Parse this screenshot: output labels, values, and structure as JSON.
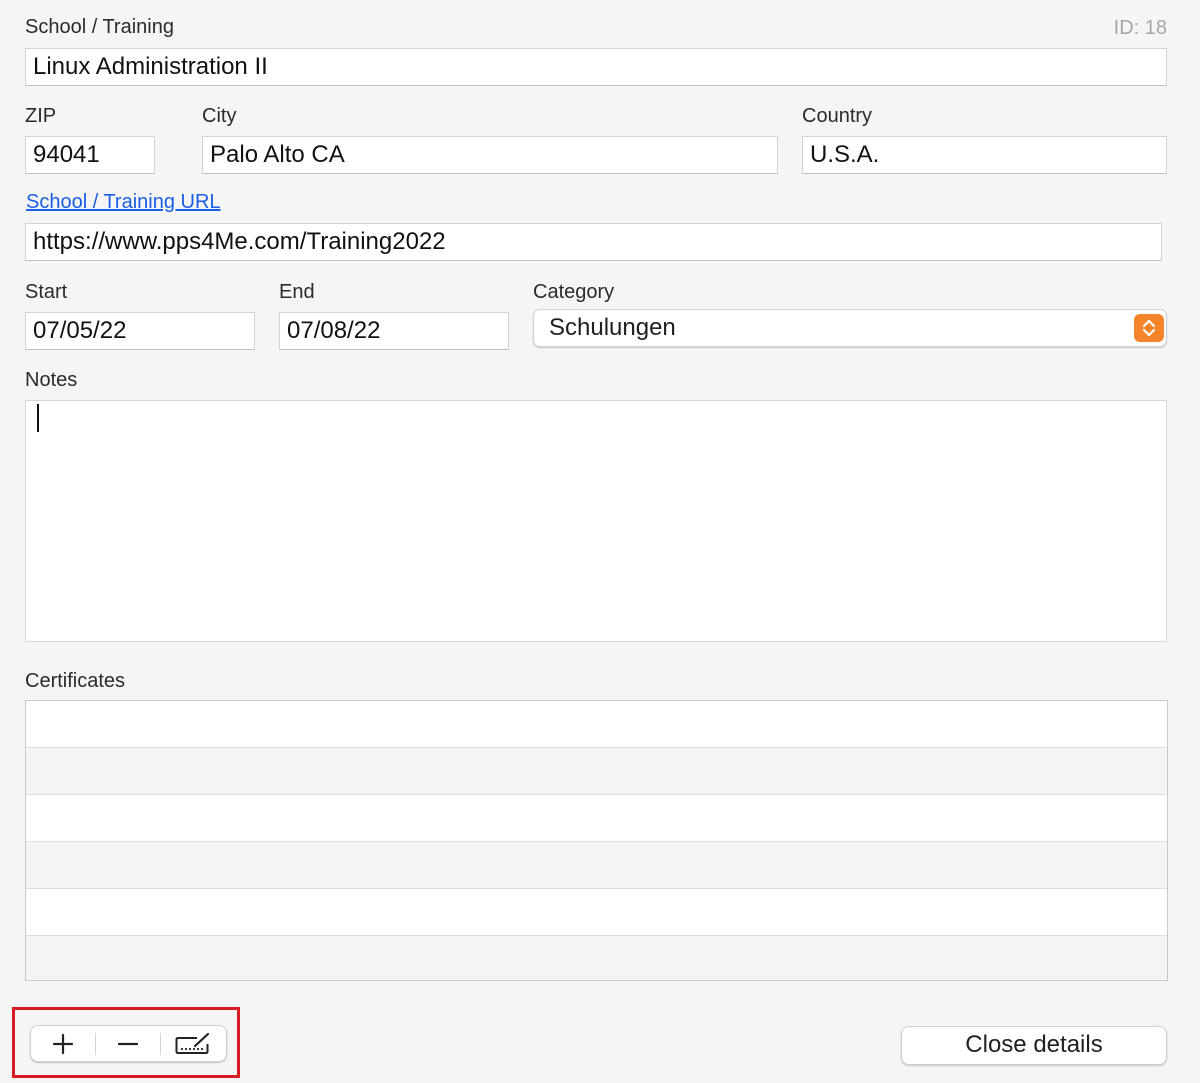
{
  "header": {
    "section_label": "School / Training",
    "id_label": "ID: 18"
  },
  "form": {
    "name_value": "Linux Administration II",
    "zip_label": "ZIP",
    "zip_value": "94041",
    "city_label": "City",
    "city_value": "Palo Alto CA",
    "country_label": "Country",
    "country_value": "U.S.A.",
    "url_link_label": "School / Training URL",
    "url_value": "https://www.pps4Me.com/Training2022",
    "start_label": "Start",
    "start_value": "07/05/22",
    "end_label": "End",
    "end_value": "07/08/22",
    "category_label": "Category",
    "category_value": "Schulungen",
    "notes_label": "Notes",
    "notes_value": ""
  },
  "certificates": {
    "label": "Certificates",
    "rows": [
      "",
      "",
      "",
      "",
      "",
      ""
    ]
  },
  "toolbar": {
    "add_icon": "plus-icon",
    "remove_icon": "minus-icon",
    "edit_icon": "keyboard-edit-icon",
    "highlight_color": "#d81b22",
    "close_label": "Close details"
  },
  "colors": {
    "link": "#1a5ee6",
    "accent": "#f5842a"
  }
}
